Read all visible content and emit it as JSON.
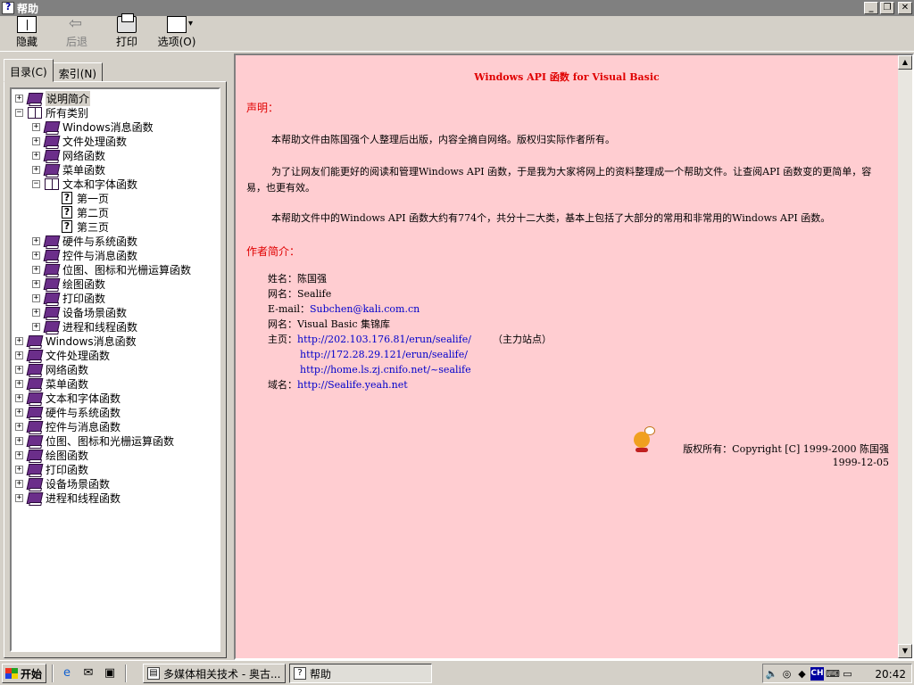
{
  "window": {
    "title": "帮助"
  },
  "toolbar": {
    "hide": "隐藏",
    "back": "后退",
    "print": "打印",
    "options": "选项(O)"
  },
  "tabs": [
    "目录(C)",
    "索引(N)"
  ],
  "tree": [
    {
      "label": "说明简介",
      "expander": "+",
      "icon": "closed-book-icon",
      "selected": true
    },
    {
      "label": "所有类别",
      "expander": "−",
      "icon": "open-book-icon"
    },
    {
      "label": "Windows消息函数",
      "expander": "+",
      "icon": "closed-book-icon"
    },
    {
      "label": "文件处理函数",
      "expander": "+",
      "icon": "closed-book-icon"
    },
    {
      "label": "网络函数",
      "expander": "+",
      "icon": "closed-book-icon"
    },
    {
      "label": "菜单函数",
      "expander": "+",
      "icon": "closed-book-icon"
    },
    {
      "label": "文本和字体函数",
      "expander": "−",
      "icon": "open-book-icon"
    },
    {
      "label": "第一页",
      "expander": "",
      "icon": "help-page-icon"
    },
    {
      "label": "第二页",
      "expander": "",
      "icon": "help-page-icon"
    },
    {
      "label": "第三页",
      "expander": "",
      "icon": "help-page-icon"
    },
    {
      "label": "硬件与系统函数",
      "expander": "+",
      "icon": "closed-book-icon"
    },
    {
      "label": "控件与消息函数",
      "expander": "+",
      "icon": "closed-book-icon"
    },
    {
      "label": "位图、图标和光栅运算函数",
      "expander": "+",
      "icon": "closed-book-icon"
    },
    {
      "label": "绘图函数",
      "expander": "+",
      "icon": "closed-book-icon"
    },
    {
      "label": "打印函数",
      "expander": "+",
      "icon": "closed-book-icon"
    },
    {
      "label": "设备场景函数",
      "expander": "+",
      "icon": "closed-book-icon"
    },
    {
      "label": "进程和线程函数",
      "expander": "+",
      "icon": "closed-book-icon"
    },
    {
      "label": "Windows消息函数",
      "expander": "+",
      "icon": "closed-book-icon"
    },
    {
      "label": "文件处理函数",
      "expander": "+",
      "icon": "closed-book-icon"
    },
    {
      "label": "网络函数",
      "expander": "+",
      "icon": "closed-book-icon"
    },
    {
      "label": "菜单函数",
      "expander": "+",
      "icon": "closed-book-icon"
    },
    {
      "label": "文本和字体函数",
      "expander": "+",
      "icon": "closed-book-icon"
    },
    {
      "label": "硬件与系统函数",
      "expander": "+",
      "icon": "closed-book-icon"
    },
    {
      "label": "控件与消息函数",
      "expander": "+",
      "icon": "closed-book-icon"
    },
    {
      "label": "位图、图标和光栅运算函数",
      "expander": "+",
      "icon": "closed-book-icon"
    },
    {
      "label": "绘图函数",
      "expander": "+",
      "icon": "closed-book-icon"
    },
    {
      "label": "打印函数",
      "expander": "+",
      "icon": "closed-book-icon"
    },
    {
      "label": "设备场景函数",
      "expander": "+",
      "icon": "closed-book-icon"
    },
    {
      "label": "进程和线程函数",
      "expander": "+",
      "icon": "closed-book-icon"
    }
  ],
  "content": {
    "title": "Windows API 函数 for Visual Basic",
    "statement_heading": "声明：",
    "paragraphs": [
      "本帮助文件由陈国强个人整理后出版，内容全摘自网络。版权归实际作者所有。",
      "为了让网友们能更好的阅读和管理Windows API 函数，于是我为大家将网上的资料整理成一个帮助文件。让查阅API 函数变的更简单，容易，也更有效。",
      "本帮助文件中的Windows API 函数大约有774个，共分十二大类，基本上包括了大部分的常用和非常用的Windows API 函数。"
    ],
    "author_heading": "作者简介：",
    "name_label": "姓名：",
    "name": "陈国强",
    "nick_label": "网名：",
    "nick": "Sealife",
    "email_label": "E-mail：",
    "email": "Subchen@kali.com.cn",
    "site_label": "网名：",
    "site_name": "Visual Basic 集锦库",
    "homepage_label": "主页：",
    "homepages": [
      "http://202.103.176.81/erun/sealife/",
      "http://172.28.29.121/erun/sealife/",
      "http://home.ls.zj.cnifo.net/~sealife"
    ],
    "main_site_note": "（主力站点）",
    "domain_label": "域名：",
    "domain": "http://Sealife.yeah.net",
    "copyright": "版权所有：Copyright [C] 1999-2000 陈国强",
    "date": "1999-12-05"
  },
  "taskbar": {
    "start": "开始",
    "tasks": [
      "多媒体相关技术 - 奥古...",
      "帮助"
    ],
    "ime": "CH",
    "clock": "20:42"
  },
  "colors": {
    "content_bg": "#ffcdd1",
    "heading_red": "#e00000",
    "link_blue": "#0000cc",
    "book_purple": "#6b2e8a",
    "chrome": "#d4d0c8"
  }
}
